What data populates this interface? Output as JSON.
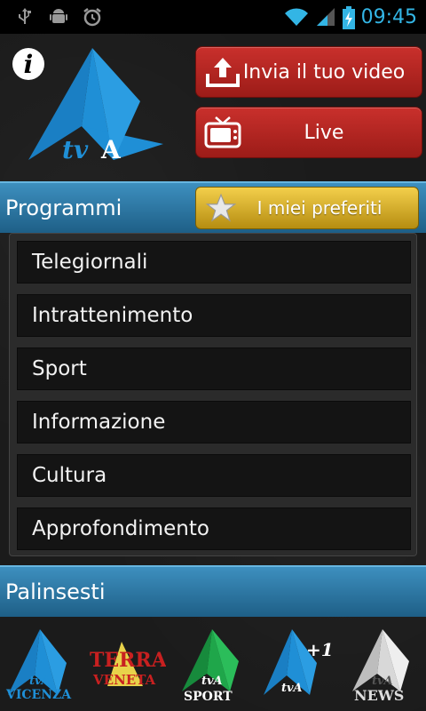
{
  "status_bar": {
    "time": "09:45",
    "icons": [
      "usb-icon",
      "android-debug-icon",
      "alarm-icon",
      "wifi-icon",
      "signal-icon",
      "battery-charging-icon"
    ]
  },
  "header": {
    "info_icon": "info-icon",
    "logo_text": "tvA",
    "upload_button": {
      "label": "Invia il tuo video",
      "icon": "upload-icon"
    },
    "live_button": {
      "label": "Live",
      "icon": "tv-icon"
    }
  },
  "programmi": {
    "title": "Programmi",
    "favorites_button": {
      "label": "I miei preferiti",
      "icon": "star-icon"
    },
    "items": [
      {
        "label": "Telegiornali"
      },
      {
        "label": "Intrattenimento"
      },
      {
        "label": "Sport"
      },
      {
        "label": "Informazione"
      },
      {
        "label": "Cultura"
      },
      {
        "label": "Approfondimento"
      }
    ]
  },
  "palinsesti": {
    "title": "Palinsesti",
    "channels": [
      {
        "name": "tvA VICENZA",
        "top": "tvA",
        "bottom": "VICENZA",
        "color": "#1f8fd6"
      },
      {
        "name": "TERRA VENETA",
        "top": "TERRA",
        "bottom": "VENETA",
        "color": "#d33"
      },
      {
        "name": "tvA SPORT",
        "top": "tvA",
        "bottom": "SPORT",
        "color": "#1fa64a"
      },
      {
        "name": "tvA +1",
        "top": "tvA",
        "bottom": "+1",
        "color": "#1f8fd6"
      },
      {
        "name": "tvA NEWS",
        "top": "tvA",
        "bottom": "NEWS",
        "color": "#cccccc"
      }
    ]
  },
  "colors": {
    "accent_blue": "#33b5e5",
    "bar_blue": "#2a73a0",
    "button_red": "#b5241f",
    "button_gold": "#d6a923"
  }
}
